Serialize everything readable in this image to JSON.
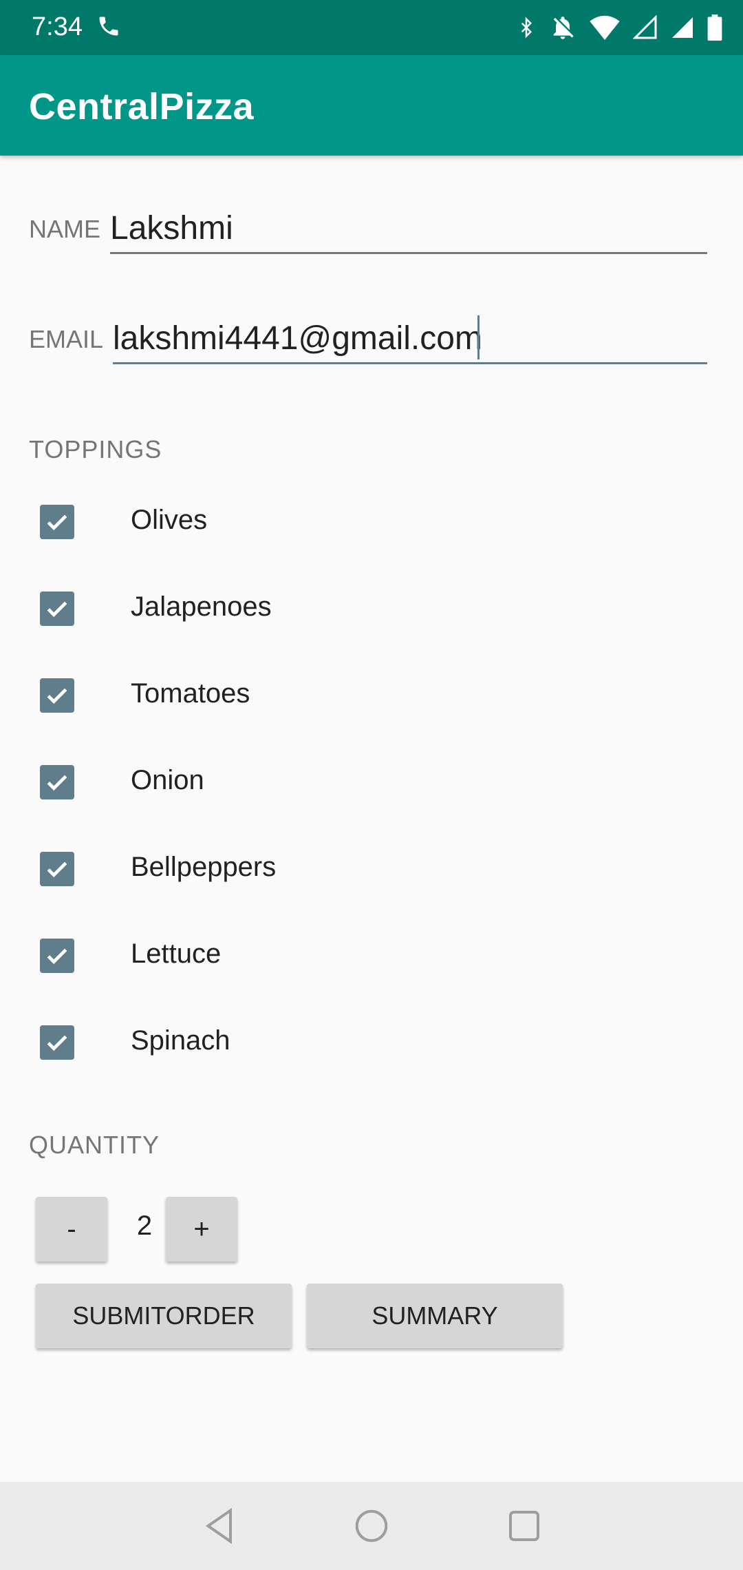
{
  "status_bar": {
    "time": "7:34",
    "icons": [
      "phone-icon",
      "bluetooth-icon",
      "notifications-off-icon",
      "wifi-icon",
      "signal-empty-icon",
      "signal-full-icon",
      "battery-icon"
    ]
  },
  "app_bar": {
    "title": "CentralPizza",
    "color": "#009688"
  },
  "form": {
    "name_label": "NAME",
    "name_value": "Lakshmi",
    "email_label": "EMAIL",
    "email_value": "lakshmi4441@gmail.com"
  },
  "toppings": {
    "label": "TOPPINGS",
    "items": [
      {
        "label": "Olives",
        "checked": true
      },
      {
        "label": "Jalapenoes",
        "checked": true
      },
      {
        "label": "Tomatoes",
        "checked": true
      },
      {
        "label": "Onion",
        "checked": true
      },
      {
        "label": "Bellpeppers",
        "checked": true
      },
      {
        "label": "Lettuce",
        "checked": true
      },
      {
        "label": "Spinach",
        "checked": true
      }
    ]
  },
  "quantity": {
    "label": "QUANTITY",
    "decrement_label": "-",
    "value": "2",
    "increment_label": "+"
  },
  "actions": {
    "submit_label": "SUBMITORDER",
    "summary_label": "SUMMARY"
  },
  "nav": {
    "icons": [
      "back-icon",
      "home-icon",
      "recents-icon"
    ]
  },
  "colors": {
    "status_bar": "#00796b",
    "accent": "#607d8b",
    "background": "#fafafa"
  }
}
